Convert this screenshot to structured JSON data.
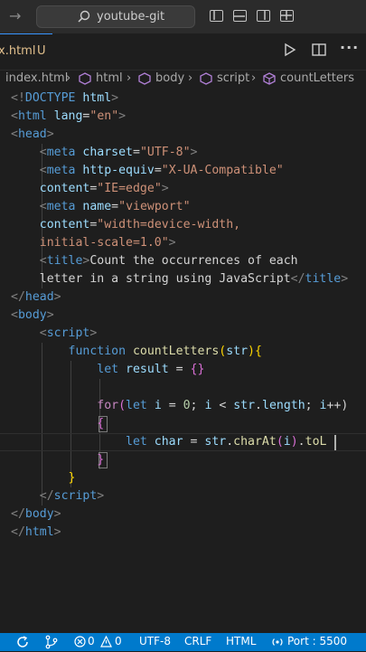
{
  "titlebar": {
    "search_text": "youtube-git"
  },
  "tab": {
    "name": "x.html",
    "status": "U"
  },
  "breadcrumb": {
    "file": "index.html",
    "sep": "›",
    "items": [
      "html",
      "body",
      "script",
      "countLetters"
    ]
  },
  "code": {
    "lines": [
      [
        [
          "<!",
          "pun"
        ],
        [
          "DOCTYPE",
          "tag"
        ],
        [
          " html",
          "attr"
        ],
        [
          ">",
          "pun"
        ]
      ],
      [
        [
          "<",
          "pun"
        ],
        [
          "html",
          "tag"
        ],
        [
          " lang",
          "attr"
        ],
        [
          "=",
          "txt"
        ],
        [
          "\"en\"",
          "str"
        ],
        [
          ">",
          "pun"
        ]
      ],
      [
        [
          "<",
          "pun"
        ],
        [
          "head",
          "tag"
        ],
        [
          ">",
          "pun"
        ]
      ],
      [
        [
          "    <",
          "pun"
        ],
        [
          "meta",
          "tag"
        ],
        [
          " charset",
          "attr"
        ],
        [
          "=",
          "txt"
        ],
        [
          "\"UTF-8\"",
          "str"
        ],
        [
          ">",
          "pun"
        ]
      ],
      [
        [
          "    <",
          "pun"
        ],
        [
          "meta",
          "tag"
        ],
        [
          " http-equiv",
          "attr"
        ],
        [
          "=",
          "txt"
        ],
        [
          "\"X-UA-Compatible\"",
          "str"
        ]
      ],
      [
        [
          "    content",
          "attr"
        ],
        [
          "=",
          "txt"
        ],
        [
          "\"IE=edge\"",
          "str"
        ],
        [
          ">",
          "pun"
        ]
      ],
      [
        [
          "    <",
          "pun"
        ],
        [
          "meta",
          "tag"
        ],
        [
          " name",
          "attr"
        ],
        [
          "=",
          "txt"
        ],
        [
          "\"viewport\"",
          "str"
        ]
      ],
      [
        [
          "    content",
          "attr"
        ],
        [
          "=",
          "txt"
        ],
        [
          "\"width=device-width,",
          "str"
        ]
      ],
      [
        [
          "    initial-scale=1.0\"",
          "str"
        ],
        [
          ">",
          "pun"
        ]
      ],
      [
        [
          "    <",
          "pun"
        ],
        [
          "title",
          "tag"
        ],
        [
          ">",
          "pun"
        ],
        [
          "Count the occurrences of each",
          "txt"
        ]
      ],
      [
        [
          "    letter in a string using JavaScript",
          "txt"
        ],
        [
          "</",
          "pun"
        ],
        [
          "title",
          "tag"
        ],
        [
          ">",
          "pun"
        ]
      ],
      [
        [
          "</",
          "pun"
        ],
        [
          "head",
          "tag"
        ],
        [
          ">",
          "pun"
        ]
      ],
      [
        [
          "<",
          "pun"
        ],
        [
          "body",
          "tag"
        ],
        [
          ">",
          "pun"
        ]
      ],
      [
        [
          "    <",
          "pun"
        ],
        [
          "script",
          "tag"
        ],
        [
          ">",
          "pun"
        ]
      ],
      [
        [
          "        function",
          "kw"
        ],
        [
          " countLetters",
          "fn"
        ],
        [
          "(",
          "br1"
        ],
        [
          "str",
          "var"
        ],
        [
          ")",
          "br1"
        ],
        [
          "{",
          "br1"
        ]
      ],
      [
        [
          "            let",
          "kw"
        ],
        [
          " result",
          "var"
        ],
        [
          " = ",
          "txt"
        ],
        [
          "{}",
          "br2"
        ]
      ],
      [],
      [
        [
          "            for",
          "ctl"
        ],
        [
          "(",
          "br2"
        ],
        [
          "let",
          "kw"
        ],
        [
          " i",
          "var"
        ],
        [
          " = ",
          "txt"
        ],
        [
          "0",
          "num"
        ],
        [
          "; ",
          "txt"
        ],
        [
          "i",
          "var"
        ],
        [
          " < ",
          "txt"
        ],
        [
          "str",
          "var"
        ],
        [
          ".",
          "txt"
        ],
        [
          "length",
          "var"
        ],
        [
          "; ",
          "txt"
        ],
        [
          "i",
          "var"
        ],
        [
          "++)",
          "txt"
        ]
      ],
      [
        [
          "            {",
          "br2"
        ]
      ],
      [
        [
          "                let",
          "kw"
        ],
        [
          " char",
          "var"
        ],
        [
          " = ",
          "txt"
        ],
        [
          "str",
          "var"
        ],
        [
          ".",
          "txt"
        ],
        [
          "charAt",
          "fn"
        ],
        [
          "(",
          "br2"
        ],
        [
          "i",
          "var"
        ],
        [
          ")",
          "br2"
        ],
        [
          ".",
          "txt"
        ],
        [
          "toL",
          "fn"
        ]
      ],
      [
        [
          "            }",
          "br2"
        ]
      ],
      [
        [
          "        }",
          "br1"
        ]
      ],
      [
        [
          "    </",
          "pun"
        ],
        [
          "script",
          "tag"
        ],
        [
          ">",
          "pun"
        ]
      ],
      [
        [
          "</",
          "pun"
        ],
        [
          "body",
          "tag"
        ],
        [
          ">",
          "pun"
        ]
      ],
      [
        [
          "</",
          "pun"
        ],
        [
          "html",
          "tag"
        ],
        [
          ">",
          "pun"
        ]
      ]
    ]
  },
  "statusbar": {
    "errors": "0",
    "warnings": "0",
    "encoding": "UTF-8",
    "eol": "CRLF",
    "language": "HTML",
    "port": "Port : 5500"
  },
  "icons": [
    "back-arrow-icon",
    "search-icon",
    "layout-icon",
    "run-icon",
    "split-editor-icon",
    "more-icon",
    "sync-icon",
    "remote-icon",
    "error-icon",
    "warning-icon",
    "broadcast-icon"
  ],
  "colors": {
    "editor_bg": "#1e1e1e",
    "statusbar_bg": "#007acc",
    "tag": "#569cd6",
    "attribute": "#9cdcfe",
    "string": "#ce9178",
    "function": "#dcdcaa"
  }
}
